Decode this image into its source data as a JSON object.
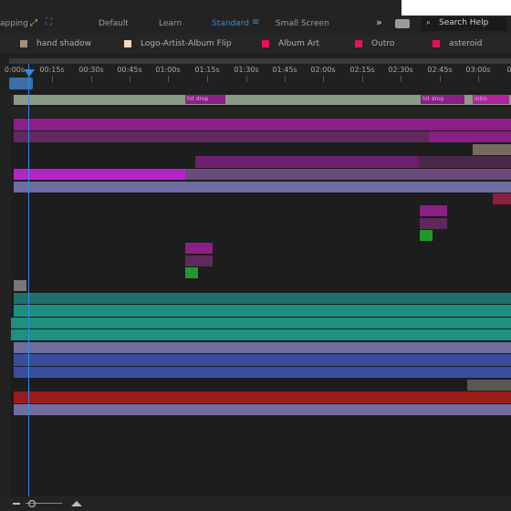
{
  "topbar": {
    "app_fragment": "apping",
    "workspaces": [
      {
        "label": "Default",
        "active": false
      },
      {
        "label": "Learn",
        "active": false
      },
      {
        "label": "Standard",
        "active": true
      },
      {
        "label": "Small Screen",
        "active": false
      }
    ],
    "search_label": "Search Help",
    "icons": [
      "expand-icon",
      "fullscreen-icon",
      "menu-icon",
      "more-icon",
      "workspace-icon",
      "search-icon"
    ]
  },
  "tabs": [
    {
      "label": "hand shadow",
      "color": "#a09080"
    },
    {
      "label": "Logo-Artist-Album Flip",
      "color": "#f0d8c8"
    },
    {
      "label": "Album Art",
      "color": "#e8105a"
    },
    {
      "label": "Outro",
      "color": "#e8105a"
    },
    {
      "label": "asteroid",
      "color": "#e8105a"
    }
  ],
  "ruler": {
    "ticks": [
      "0:00s",
      "00:15s",
      "00:30s",
      "00:45s",
      "01:00s",
      "01:15s",
      "01:30s",
      "01:45s",
      "02:00s",
      "02:15s",
      "02:30s",
      "02:45s",
      "03:00s",
      "0"
    ]
  },
  "markers": [
    "hit drop",
    "hit drop",
    "intro"
  ],
  "colors": {
    "accent": "#2d8ceb",
    "magenta": "#8a1f86",
    "teal": "#1e8f80",
    "blue": "#3a4d9c",
    "red": "#9b1b1b"
  }
}
